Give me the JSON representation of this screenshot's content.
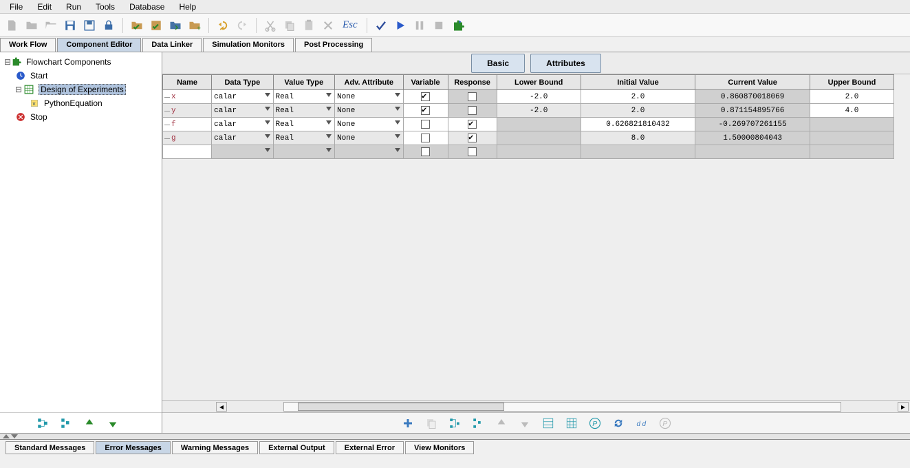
{
  "menu": [
    "File",
    "Edit",
    "Run",
    "Tools",
    "Database",
    "Help"
  ],
  "top_tabs": [
    {
      "label": "Work Flow",
      "active": false
    },
    {
      "label": "Component Editor",
      "active": true
    },
    {
      "label": "Data Linker",
      "active": false
    },
    {
      "label": "Simulation Monitors",
      "active": false
    },
    {
      "label": "Post Processing",
      "active": false
    }
  ],
  "tree": {
    "root": "Flowchart Components",
    "children": [
      {
        "label": "Start",
        "icon": "start"
      },
      {
        "label": "Design of Experiments",
        "icon": "doe",
        "selected": true,
        "children": [
          {
            "label": "PythonEquation",
            "icon": "python"
          }
        ]
      },
      {
        "label": "Stop",
        "icon": "stop"
      }
    ]
  },
  "view_tabs": [
    {
      "label": "Basic"
    },
    {
      "label": "Attributes"
    }
  ],
  "grid": {
    "columns": [
      "Name",
      "Data Type",
      "Value Type",
      "Adv. Attribute",
      "Variable",
      "Response",
      "Lower Bound",
      "Initial Value",
      "Current Value",
      "Upper Bound"
    ],
    "rows": [
      {
        "name": "x",
        "data_type": "calar",
        "value_type": "Real",
        "adv_attr": "None",
        "variable": true,
        "response": false,
        "lower": "-2.0",
        "initial": "2.0",
        "current": "0.860870018069",
        "upper": "2.0",
        "shade": "white",
        "resp_bg": "gray"
      },
      {
        "name": "y",
        "data_type": "calar",
        "value_type": "Real",
        "adv_attr": "None",
        "variable": true,
        "response": false,
        "lower": "-2.0",
        "initial": "2.0",
        "current": "0.871154895766",
        "upper": "4.0",
        "shade": "light",
        "resp_bg": "gray"
      },
      {
        "name": "f",
        "data_type": "calar",
        "value_type": "Real",
        "adv_attr": "None",
        "variable": false,
        "response": true,
        "lower": "",
        "initial": "0.626821810432",
        "current": "-0.269707261155",
        "upper": "",
        "shade": "white",
        "resp_bg": "white"
      },
      {
        "name": "g",
        "data_type": "calar",
        "value_type": "Real",
        "adv_attr": "None",
        "variable": false,
        "response": true,
        "lower": "",
        "initial": "8.0",
        "current": "1.50000804043",
        "upper": "",
        "shade": "light",
        "resp_bg": "light"
      },
      {
        "name": "",
        "data_type": "",
        "value_type": "",
        "adv_attr": "",
        "variable": false,
        "response": false,
        "lower": "",
        "initial": "",
        "current": "",
        "upper": "",
        "shade": "empty"
      }
    ]
  },
  "bottom_tabs": [
    {
      "label": "Standard Messages",
      "active": false
    },
    {
      "label": "Error Messages",
      "active": true
    },
    {
      "label": "Warning Messages",
      "active": false
    },
    {
      "label": "External Output",
      "active": false
    },
    {
      "label": "External Error",
      "active": false
    },
    {
      "label": "View Monitors",
      "active": false
    }
  ],
  "esc_label": "Esc"
}
